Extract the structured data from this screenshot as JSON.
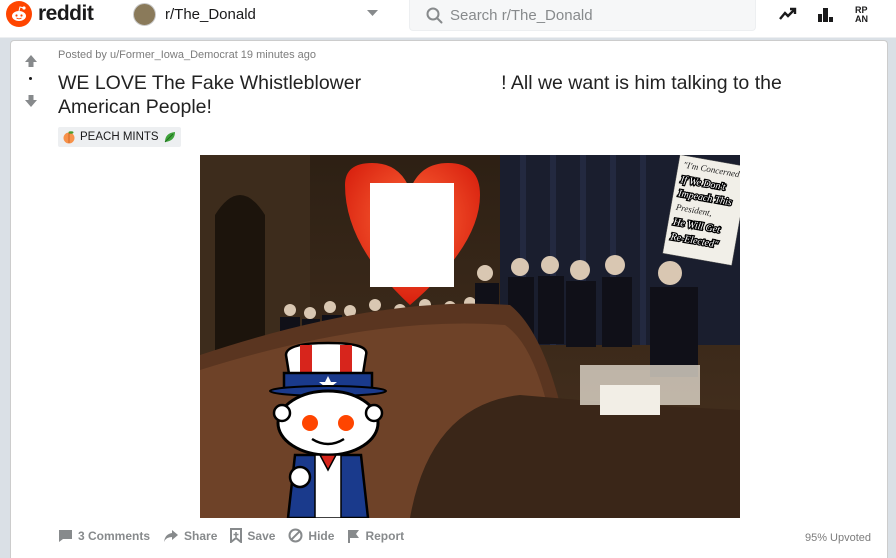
{
  "header": {
    "logo_text": "reddit",
    "subreddit": "r/The_Donald",
    "search_placeholder": "Search r/The_Donald",
    "icons": [
      "trending-icon",
      "leaderboard-icon",
      "rpan-icon"
    ],
    "rpan_label": "RP\nAN"
  },
  "post": {
    "meta": "Posted by u/Former_Iowa_Democrat 19 minutes ago",
    "title_part1": "WE LOVE The Fake Whistleblower",
    "title_part2": "! All we want is him talking to the American People!",
    "flair": "PEACH MINTS",
    "image_sign_text": [
      "\"I'm Concerned",
      "If We Don't",
      "Impeach This",
      "President,",
      "He Will Get",
      "Re-Elected\""
    ],
    "actions": {
      "comments": "3 Comments",
      "share": "Share",
      "save": "Save",
      "hide": "Hide",
      "report": "Report"
    },
    "upvoted": "95% Upvoted"
  },
  "colors": {
    "brand": "#ff4500",
    "background": "#dae0e6",
    "muted": "#878a8c"
  }
}
